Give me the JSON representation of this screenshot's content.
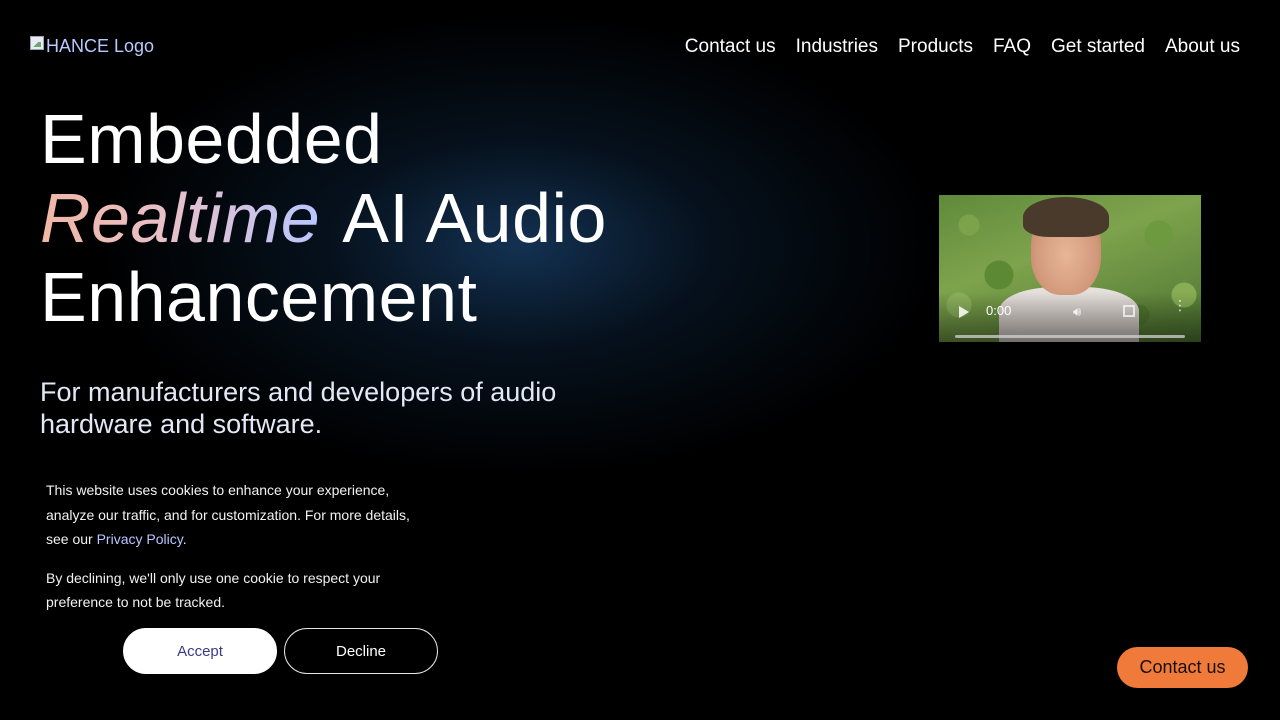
{
  "header": {
    "logo_alt": "HANCE Logo",
    "nav": [
      {
        "label": "Contact us"
      },
      {
        "label": "Industries"
      },
      {
        "label": "Products"
      },
      {
        "label": "FAQ"
      },
      {
        "label": "Get started"
      },
      {
        "label": "About us"
      }
    ]
  },
  "hero": {
    "title_line1": "Embedded",
    "title_accent": "Realtime",
    "title_line2_rest": "AI Audio",
    "title_line3": "Enhancement",
    "subtitle": "For manufacturers and developers of audio hardware and software."
  },
  "video": {
    "time": "0:00"
  },
  "cookie": {
    "text1": "This website uses cookies to enhance your experience, analyze our traffic, and for customization. For more details, see our",
    "policy_link": "Privacy Policy",
    "text1_end": ".",
    "text2": "By declining, we'll only use one cookie to respect your preference to not be tracked.",
    "accept_label": "Accept",
    "decline_label": "Decline"
  },
  "floating": {
    "contact_label": "Contact us"
  },
  "colors": {
    "accent_orange": "#f07a3a",
    "link_blue": "#b9c6ff"
  }
}
